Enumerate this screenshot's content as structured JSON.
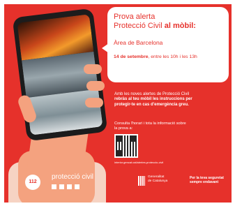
{
  "colors": {
    "brand_red": "#e6312b",
    "bubble_bg": "#ffffff"
  },
  "bubble": {
    "title_line1": "Prova alerta",
    "title_line2_plain": "Protecció Civil ",
    "title_line2_bold": "al mòbil:",
    "area": "Àrea de Barcelona",
    "date_bold": "14 de setembre",
    "date_rest": ", entre les 10h i les 13h"
  },
  "info": {
    "line1": "Amb les noves alertes de Protecció Civil",
    "line2": "rebràs al teu mòbil les instruccions per",
    "line3": "protegir-te en cas d'emergència greu."
  },
  "consulta": {
    "line1": "Consulta l'horari i tota la informació sobre",
    "line2": "la prova a:"
  },
  "qr": {
    "icon": "qr-code-icon"
  },
  "url": "interior.gencat.cat/alertes-proteccio-civil",
  "footer": {
    "logo_112": "112",
    "protection_name": "protecció civil",
    "generalitat_line1": "Generalitat",
    "generalitat_line2": "de Catalunya",
    "slogan_line1": "Per la teva seguretat",
    "slogan_line2": "sempre endavant"
  }
}
